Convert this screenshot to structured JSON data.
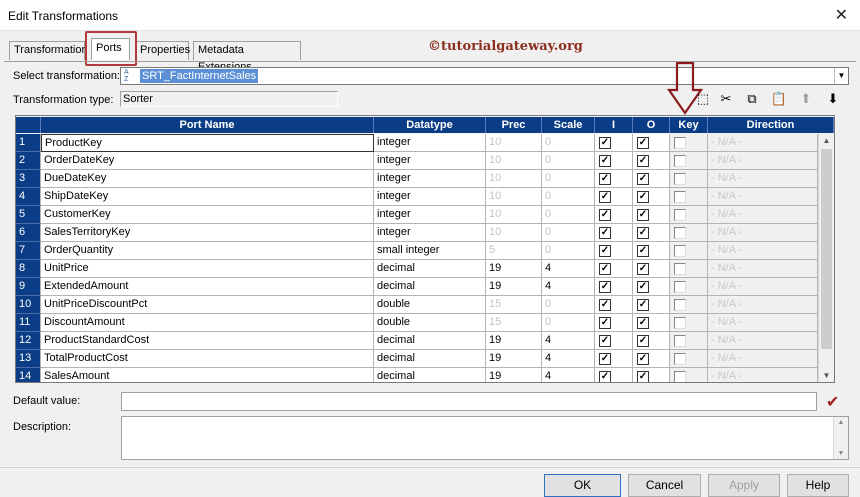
{
  "window": {
    "title": "Edit Transformations",
    "close_glyph": "✕"
  },
  "tabs": [
    {
      "label": "Transformation"
    },
    {
      "label": "Ports"
    },
    {
      "label": "Properties"
    },
    {
      "label": "Metadata Extensions"
    }
  ],
  "active_tab": "Ports",
  "watermark": "©tutorialgateway.org",
  "select_transformation": {
    "label": "Select transformation:",
    "value": "SRT_FactInternetSales",
    "sort_icon": "A Z"
  },
  "transformation_type": {
    "label": "Transformation type:",
    "value": "Sorter"
  },
  "toolbar": [
    {
      "icon": "new-port-icon",
      "glyph": "⬚",
      "enabled": true
    },
    {
      "icon": "cut-icon",
      "glyph": "✂",
      "enabled": true
    },
    {
      "icon": "copy-icon",
      "glyph": "⧉",
      "enabled": true
    },
    {
      "icon": "paste-icon",
      "glyph": "📋",
      "enabled": false
    },
    {
      "icon": "move-up-icon",
      "glyph": "⬆",
      "enabled": false
    },
    {
      "icon": "move-down-icon",
      "glyph": "⬇",
      "enabled": true
    }
  ],
  "grid": {
    "columns": [
      "Port Name",
      "Datatype",
      "Prec",
      "Scale",
      "I",
      "O",
      "Key",
      "Direction"
    ],
    "rows": [
      {
        "n": "1",
        "name": "ProductKey",
        "type": "integer",
        "prec": "10",
        "scale": "0",
        "i": true,
        "o": true,
        "key": false,
        "dir": "- N/A -",
        "prec_dim": true
      },
      {
        "n": "2",
        "name": "OrderDateKey",
        "type": "integer",
        "prec": "10",
        "scale": "0",
        "i": true,
        "o": true,
        "key": false,
        "dir": "- N/A -",
        "prec_dim": true
      },
      {
        "n": "3",
        "name": "DueDateKey",
        "type": "integer",
        "prec": "10",
        "scale": "0",
        "i": true,
        "o": true,
        "key": false,
        "dir": "- N/A -",
        "prec_dim": true
      },
      {
        "n": "4",
        "name": "ShipDateKey",
        "type": "integer",
        "prec": "10",
        "scale": "0",
        "i": true,
        "o": true,
        "key": false,
        "dir": "- N/A -",
        "prec_dim": true
      },
      {
        "n": "5",
        "name": "CustomerKey",
        "type": "integer",
        "prec": "10",
        "scale": "0",
        "i": true,
        "o": true,
        "key": false,
        "dir": "- N/A -",
        "prec_dim": true
      },
      {
        "n": "6",
        "name": "SalesTerritoryKey",
        "type": "integer",
        "prec": "10",
        "scale": "0",
        "i": true,
        "o": true,
        "key": false,
        "dir": "- N/A -",
        "prec_dim": true
      },
      {
        "n": "7",
        "name": "OrderQuantity",
        "type": "small integer",
        "prec": "5",
        "scale": "0",
        "i": true,
        "o": true,
        "key": false,
        "dir": "- N/A -",
        "prec_dim": true
      },
      {
        "n": "8",
        "name": "UnitPrice",
        "type": "decimal",
        "prec": "19",
        "scale": "4",
        "i": true,
        "o": true,
        "key": false,
        "dir": "- N/A -",
        "prec_dim": false
      },
      {
        "n": "9",
        "name": "ExtendedAmount",
        "type": "decimal",
        "prec": "19",
        "scale": "4",
        "i": true,
        "o": true,
        "key": false,
        "dir": "- N/A -",
        "prec_dim": false
      },
      {
        "n": "10",
        "name": "UnitPriceDiscountPct",
        "type": "double",
        "prec": "15",
        "scale": "0",
        "i": true,
        "o": true,
        "key": false,
        "dir": "- N/A -",
        "prec_dim": true
      },
      {
        "n": "11",
        "name": "DiscountAmount",
        "type": "double",
        "prec": "15",
        "scale": "0",
        "i": true,
        "o": true,
        "key": false,
        "dir": "- N/A -",
        "prec_dim": true
      },
      {
        "n": "12",
        "name": "ProductStandardCost",
        "type": "decimal",
        "prec": "19",
        "scale": "4",
        "i": true,
        "o": true,
        "key": false,
        "dir": "- N/A -",
        "prec_dim": false
      },
      {
        "n": "13",
        "name": "TotalProductCost",
        "type": "decimal",
        "prec": "19",
        "scale": "4",
        "i": true,
        "o": true,
        "key": false,
        "dir": "- N/A -",
        "prec_dim": false
      },
      {
        "n": "14",
        "name": "SalesAmount",
        "type": "decimal",
        "prec": "19",
        "scale": "4",
        "i": true,
        "o": true,
        "key": false,
        "dir": "- N/A -",
        "prec_dim": false
      }
    ]
  },
  "default_value": {
    "label": "Default value:",
    "value": ""
  },
  "description": {
    "label": "Description:",
    "value": ""
  },
  "buttons": {
    "ok": "OK",
    "cancel": "Cancel",
    "apply": "Apply",
    "help": "Help"
  },
  "colors": {
    "grid_header": "#0a3d86",
    "highlight_annotation": "#b23a3a",
    "watermark": "#8b2f1f"
  }
}
